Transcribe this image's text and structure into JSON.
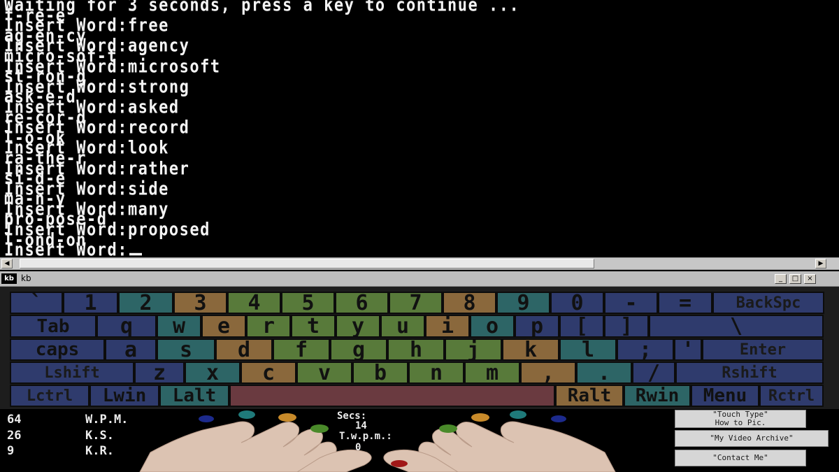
{
  "console": {
    "lines": [
      "Waiting for 3 seconds, press a key to continue ...",
      "f-re-e",
      "Insert Word:free",
      "ag-en-cy",
      "Insert Word:agency",
      "micro-sof-t",
      "Insert Word:microsoft",
      "st-ron-g",
      "Insert Word:strong",
      "ask-e-d",
      "Insert Word:asked",
      "re-cor-d",
      "Insert Word:record",
      "l-o-ok",
      "Insert Word:look",
      "ra-the-r",
      "Insert Word:rather",
      "si-d-e",
      "Insert Word:side",
      "ma-n-y",
      "Insert Word:many",
      "pro-pose-d",
      "Insert Word:proposed",
      "l-ond-on",
      "Insert Word:"
    ]
  },
  "scrollbar": {
    "left_arrow": "◀",
    "right_arrow": "▶"
  },
  "window": {
    "icon_text": "kb",
    "title": "kb",
    "minimize": "_",
    "maximize": "□",
    "close": "×"
  },
  "colors": {
    "pinky": "#2f4f6e",
    "ring": "#2e6a6a",
    "middle": "#8a6a3e",
    "index": "#5c7a3c",
    "index_alt": "#8a6a3e",
    "thumb": "#6a3a40",
    "neutral": "#353c6e",
    "gray": "#4a5060",
    "right_ring": "#306868",
    "right_pinky": "#353c6e"
  },
  "keyboard": {
    "rows": [
      [
        {
          "label": "`",
          "name": "key-backtick",
          "color": "#2f3b6d"
        },
        {
          "label": "1",
          "name": "key-1",
          "color": "#2f3b6d"
        },
        {
          "label": "2",
          "name": "key-2",
          "color": "#2d6566"
        },
        {
          "label": "3",
          "name": "key-3",
          "color": "#8a683c"
        },
        {
          "label": "4",
          "name": "key-4",
          "color": "#587a3a"
        },
        {
          "label": "5",
          "name": "key-5",
          "color": "#587a3a"
        },
        {
          "label": "6",
          "name": "key-6",
          "color": "#587a3a"
        },
        {
          "label": "7",
          "name": "key-7",
          "color": "#587a3a"
        },
        {
          "label": "8",
          "name": "key-8",
          "color": "#8a683c"
        },
        {
          "label": "9",
          "name": "key-9",
          "color": "#2d6566"
        },
        {
          "label": "0",
          "name": "key-0",
          "color": "#2f3b6d"
        },
        {
          "label": "-",
          "name": "key-minus",
          "color": "#2f3b6d"
        },
        {
          "label": "=",
          "name": "key-equals",
          "color": "#2f3b6d"
        },
        {
          "label": "BackSpc",
          "name": "key-backspace",
          "color": "#2f3b6d"
        }
      ],
      [
        {
          "label": "Tab",
          "name": "key-tab",
          "color": "#2f3b6d"
        },
        {
          "label": "q",
          "name": "key-q",
          "color": "#2f3b6d"
        },
        {
          "label": "w",
          "name": "key-w",
          "color": "#2d6566"
        },
        {
          "label": "e",
          "name": "key-e",
          "color": "#8a683c"
        },
        {
          "label": "r",
          "name": "key-r",
          "color": "#587a3a"
        },
        {
          "label": "t",
          "name": "key-t",
          "color": "#587a3a"
        },
        {
          "label": "y",
          "name": "key-y",
          "color": "#587a3a"
        },
        {
          "label": "u",
          "name": "key-u",
          "color": "#587a3a"
        },
        {
          "label": "i",
          "name": "key-i",
          "color": "#8a683c"
        },
        {
          "label": "o",
          "name": "key-o",
          "color": "#2d6566"
        },
        {
          "label": "p",
          "name": "key-p",
          "color": "#2f3b6d"
        },
        {
          "label": "[",
          "name": "key-lbracket",
          "color": "#2f3b6d"
        },
        {
          "label": "]",
          "name": "key-rbracket",
          "color": "#2f3b6d"
        },
        {
          "label": "\\",
          "name": "key-backslash",
          "color": "#2f3b6d"
        }
      ],
      [
        {
          "label": "caps",
          "name": "key-caps",
          "color": "#2f3b6d"
        },
        {
          "label": "a",
          "name": "key-a",
          "color": "#2f3b6d"
        },
        {
          "label": "s",
          "name": "key-s",
          "color": "#2d6566"
        },
        {
          "label": "d",
          "name": "key-d",
          "color": "#8a683c"
        },
        {
          "label": "f",
          "name": "key-f",
          "color": "#587a3a"
        },
        {
          "label": "g",
          "name": "key-g",
          "color": "#587a3a"
        },
        {
          "label": "h",
          "name": "key-h",
          "color": "#587a3a"
        },
        {
          "label": "j",
          "name": "key-j",
          "color": "#587a3a"
        },
        {
          "label": "k",
          "name": "key-k",
          "color": "#8a683c"
        },
        {
          "label": "l",
          "name": "key-l",
          "color": "#2d6566"
        },
        {
          "label": ";",
          "name": "key-semicolon",
          "color": "#2f3b6d"
        },
        {
          "label": "'",
          "name": "key-quote",
          "color": "#2f3b6d"
        },
        {
          "label": "Enter",
          "name": "key-enter",
          "color": "#2f3b6d"
        }
      ],
      [
        {
          "label": "Lshift",
          "name": "key-lshift",
          "color": "#2f3b6d"
        },
        {
          "label": "z",
          "name": "key-z",
          "color": "#2f3b6d"
        },
        {
          "label": "x",
          "name": "key-x",
          "color": "#2d6566"
        },
        {
          "label": "c",
          "name": "key-c",
          "color": "#8a683c"
        },
        {
          "label": "v",
          "name": "key-v",
          "color": "#587a3a"
        },
        {
          "label": "b",
          "name": "key-b",
          "color": "#587a3a"
        },
        {
          "label": "n",
          "name": "key-n",
          "color": "#587a3a"
        },
        {
          "label": "m",
          "name": "key-m",
          "color": "#587a3a"
        },
        {
          "label": ",",
          "name": "key-comma",
          "color": "#8a683c"
        },
        {
          "label": ".",
          "name": "key-period",
          "color": "#2d6566"
        },
        {
          "label": "/",
          "name": "key-slash",
          "color": "#2f3b6d"
        },
        {
          "label": "Rshift",
          "name": "key-rshift",
          "color": "#2f3b6d"
        }
      ],
      [
        {
          "label": "Lctrl",
          "name": "key-lctrl",
          "color": "#2f3b6d"
        },
        {
          "label": "Lwin",
          "name": "key-lwin",
          "color": "#2f3b6d"
        },
        {
          "label": "Lalt",
          "name": "key-lalt",
          "color": "#2d6566"
        },
        {
          "label": "",
          "name": "key-space",
          "color": "#6a3a40"
        },
        {
          "label": "Ralt",
          "name": "key-ralt",
          "color": "#8a683c"
        },
        {
          "label": "Rwin",
          "name": "key-rwin",
          "color": "#2d6566"
        },
        {
          "label": "Menu",
          "name": "key-menu",
          "color": "#2f3b6d"
        },
        {
          "label": "Rctrl",
          "name": "key-rctrl",
          "color": "#2f3b6d"
        }
      ]
    ]
  },
  "stats": {
    "wpm_value": "64",
    "wpm_label": "W.P.M.",
    "ks_value": "26",
    "ks_label": "K.S.",
    "kr_value": "9",
    "kr_label": "K.R.",
    "secs_label": "Secs:",
    "secs_value": "14",
    "twpm_label": "T.w.p.m.:",
    "twpm_value": "0"
  },
  "nav": {
    "touch_type_line1": "\"Touch Type\"",
    "touch_type_line2": "How to Pic.",
    "video_archive": "\"My Video Archive\"",
    "contact": "\"Contact Me\""
  },
  "fingertips": {
    "left": [
      "#1c2a8c",
      "#1f7a7a",
      "#c88a2a",
      "#4a8a2a"
    ],
    "right": [
      "#4a8a2a",
      "#c88a2a",
      "#1f7a7a",
      "#1c2a8c"
    ],
    "thumb": "#a01818"
  }
}
